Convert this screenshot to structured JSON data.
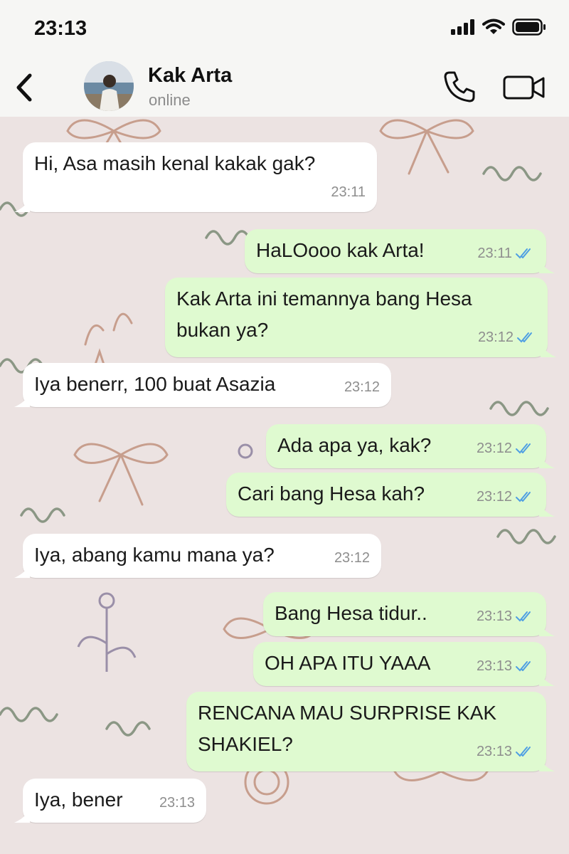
{
  "status_bar": {
    "time": "23:13"
  },
  "header": {
    "back_icon": "chevron-left-icon",
    "contact_name": "Kak Arta",
    "contact_status": "online",
    "call_icon": "phone-icon",
    "video_icon": "video-camera-icon"
  },
  "colors": {
    "incoming_bubble": "#ffffff",
    "outgoing_bubble": "#dffad0",
    "read_ticks": "#4f9fe3",
    "wallpaper": "#ece3e2"
  },
  "messages": [
    {
      "direction": "in",
      "lines": [
        "Hi, Asa masih kenal kakak gak?"
      ],
      "time": "23:11"
    },
    {
      "direction": "out",
      "lines": [
        "HaLOooo kak Arta!"
      ],
      "time": "23:11",
      "status": "read"
    },
    {
      "direction": "out",
      "lines": [
        "Kak Arta ini temannya bang Hesa",
        "bukan ya?"
      ],
      "time": "23:12",
      "status": "read"
    },
    {
      "direction": "in",
      "lines": [
        "Iya benerr, 100 buat Asazia"
      ],
      "time": "23:12"
    },
    {
      "direction": "out",
      "lines": [
        "Ada apa ya, kak?"
      ],
      "time": "23:12",
      "status": "read"
    },
    {
      "direction": "out",
      "lines": [
        "Cari bang Hesa kah?"
      ],
      "time": "23:12",
      "status": "read"
    },
    {
      "direction": "in",
      "lines": [
        "Iya, abang kamu mana ya?"
      ],
      "time": "23:12"
    },
    {
      "direction": "out",
      "lines": [
        "Bang Hesa tidur.."
      ],
      "time": "23:13",
      "status": "read"
    },
    {
      "direction": "out",
      "lines": [
        "OH APA ITU YAAA"
      ],
      "time": "23:13",
      "status": "read"
    },
    {
      "direction": "out",
      "lines": [
        "RENCANA MAU SURPRISE KAK",
        "SHAKIEL?"
      ],
      "time": "23:13",
      "status": "read"
    },
    {
      "direction": "in",
      "lines": [
        "Iya, bener"
      ],
      "time": "23:13"
    }
  ]
}
